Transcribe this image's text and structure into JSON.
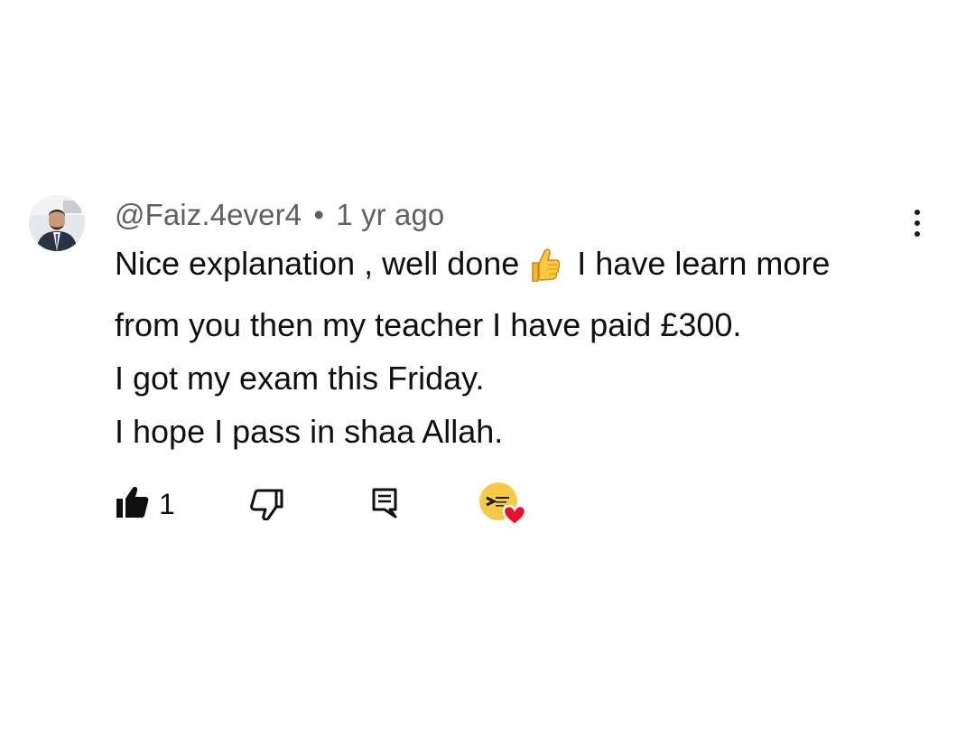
{
  "comment": {
    "author": "@Faiz.4ever4",
    "separator": "•",
    "time": "1 yr ago",
    "lines": [
      "Nice explanation , well done",
      "I have learn more",
      "from you then my teacher I have paid £300.",
      "I got my exam this Friday.",
      "I hope I pass in shaa Allah."
    ],
    "emoji_name": "thumbs-up-emoji",
    "like_count": "1"
  },
  "icons": {
    "avatar": "user-avatar-photo",
    "more": "kebab-menu-icon",
    "like": "thumbs-up-filled-icon",
    "dislike": "thumbs-down-icon",
    "reply": "reply-comment-icon",
    "creator_heart": "creator-heart-badge"
  },
  "colors": {
    "heart": "#e8112d",
    "creator_avatar": "#f7c948",
    "meta_text": "#606060"
  }
}
